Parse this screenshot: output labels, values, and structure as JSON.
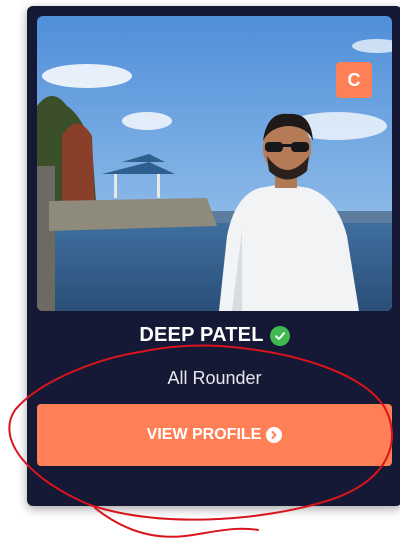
{
  "card": {
    "badge": "C",
    "name": "DEEP PATEL",
    "role": "All Rounder",
    "button_label": "VIEW PROFILE",
    "verified_icon": "check-circle-icon",
    "button_icon": "chevron-circle-right-icon"
  },
  "colors": {
    "card_background": "#161935",
    "accent": "#ff8057",
    "verified_green": "#3fb950",
    "annotation_red": "#d9141c"
  }
}
